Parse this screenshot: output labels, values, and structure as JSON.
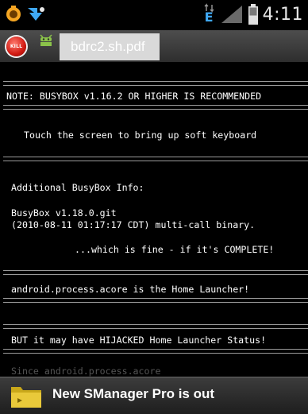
{
  "statusbar": {
    "time": "4:11",
    "network_label": "E",
    "icons": [
      "notification-app-icon",
      "download-arrow-icon",
      "data-arrows-icon",
      "signal-icon",
      "battery-icon"
    ]
  },
  "titlebar": {
    "kill_label": "KILL",
    "tab_label": "bdrc2.sh.pdf"
  },
  "terminal": {
    "note": "NOTE: BUSYBOX v1.16.2 OR HIGHER IS RECOMMENDED",
    "touch": "Touch the screen to bring up soft keyboard",
    "additional": "Additional BusyBox Info:",
    "busybox_version": "BusyBox v1.18.0.git",
    "busybox_build": "(2010-08-11 01:17:17 CDT) multi-call binary.",
    "fine": "...which is fine - if it's COMPLETE!",
    "launcher": "android.process.acore is the Home Launcher!",
    "hijacked": "BUT it may have HIJACKED Home Launcher Status!",
    "faded": "Since android.process.acore"
  },
  "toast": {
    "message": "New SManager Pro is out"
  }
}
